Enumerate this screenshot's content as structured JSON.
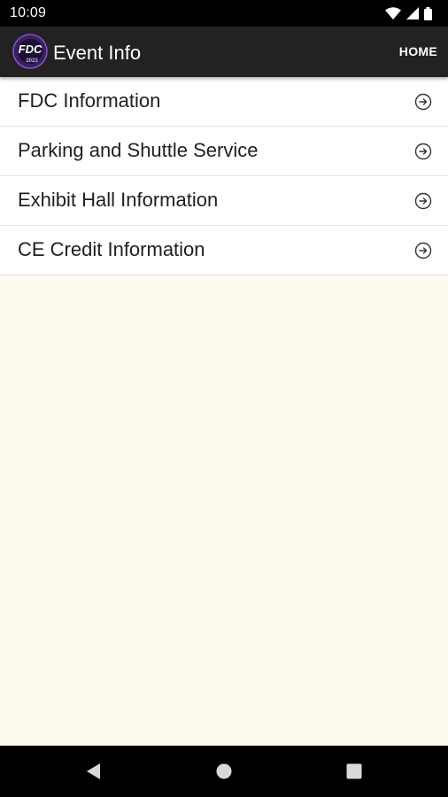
{
  "status_bar": {
    "time": "10:09",
    "icons": [
      "wifi-icon",
      "signal-icon",
      "battery-icon"
    ]
  },
  "app_bar": {
    "logo_text": "FDC",
    "logo_subtext": "2023",
    "title": "Event Info",
    "home_label": "HOME",
    "background_color": "#222222"
  },
  "menu": {
    "items": [
      {
        "label": "FDC Information",
        "icon": "chevron-right-circle-icon"
      },
      {
        "label": "Parking and Shuttle Service",
        "icon": "chevron-right-circle-icon"
      },
      {
        "label": "Exhibit Hall Information",
        "icon": "chevron-right-circle-icon"
      },
      {
        "label": "CE Credit Information",
        "icon": "chevron-right-circle-icon"
      }
    ]
  },
  "nav_bar": {
    "buttons": [
      "back-icon",
      "home-circle-icon",
      "recents-icon"
    ]
  },
  "colors": {
    "content_background": "#fdfaf0",
    "logo_accent": "#5b2d8f"
  }
}
